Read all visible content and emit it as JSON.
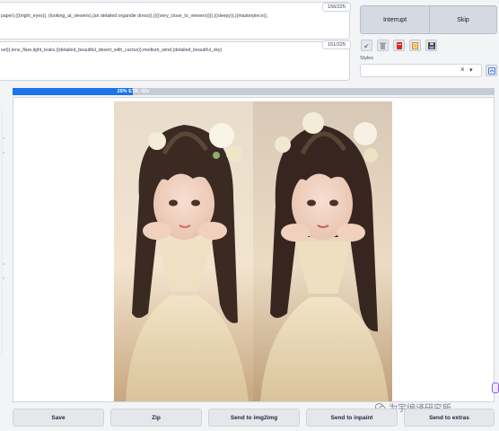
{
  "prompts": {
    "positive_text": "paper),((bright_eyes)), (looking_at_viewers),(an detailed organdie dress)),((((very_close_to_viewers)))),((sleepy)),((masterpiece)),",
    "positive_counter": "156/225",
    "negative_text": "set)),lens_flare,light_leaks,((detailed_beautiful_desert_with_cactus)),medium_wind,(detailed_beautiful_sky)",
    "negative_counter": "151/225"
  },
  "controls": {
    "interrupt_label": "Interrupt",
    "skip_label": "Skip",
    "tools": [
      {
        "name": "arrow-icon",
        "glyph": "↙"
      },
      {
        "name": "trash-icon",
        "glyph": "🗑"
      },
      {
        "name": "style-red-icon",
        "glyph": "▮"
      },
      {
        "name": "clipboard-icon",
        "glyph": "▤"
      },
      {
        "name": "save-icon",
        "glyph": "💾"
      }
    ],
    "styles_label": "Styles",
    "styles_clear": "×",
    "styles_dropdown": "▾",
    "refresh_glyph": "⟳"
  },
  "progress": {
    "text": "25% ETA: 42s",
    "fraction": 0.25
  },
  "actions": {
    "save": "Save",
    "zip": "Zip",
    "img2img": "Send to img2img",
    "inpaint": "Send to inpaint",
    "extras": "Send to extras"
  },
  "watermark": {
    "text": "为宇编译研究所"
  },
  "colors": {
    "accent": "#1d73e8"
  }
}
